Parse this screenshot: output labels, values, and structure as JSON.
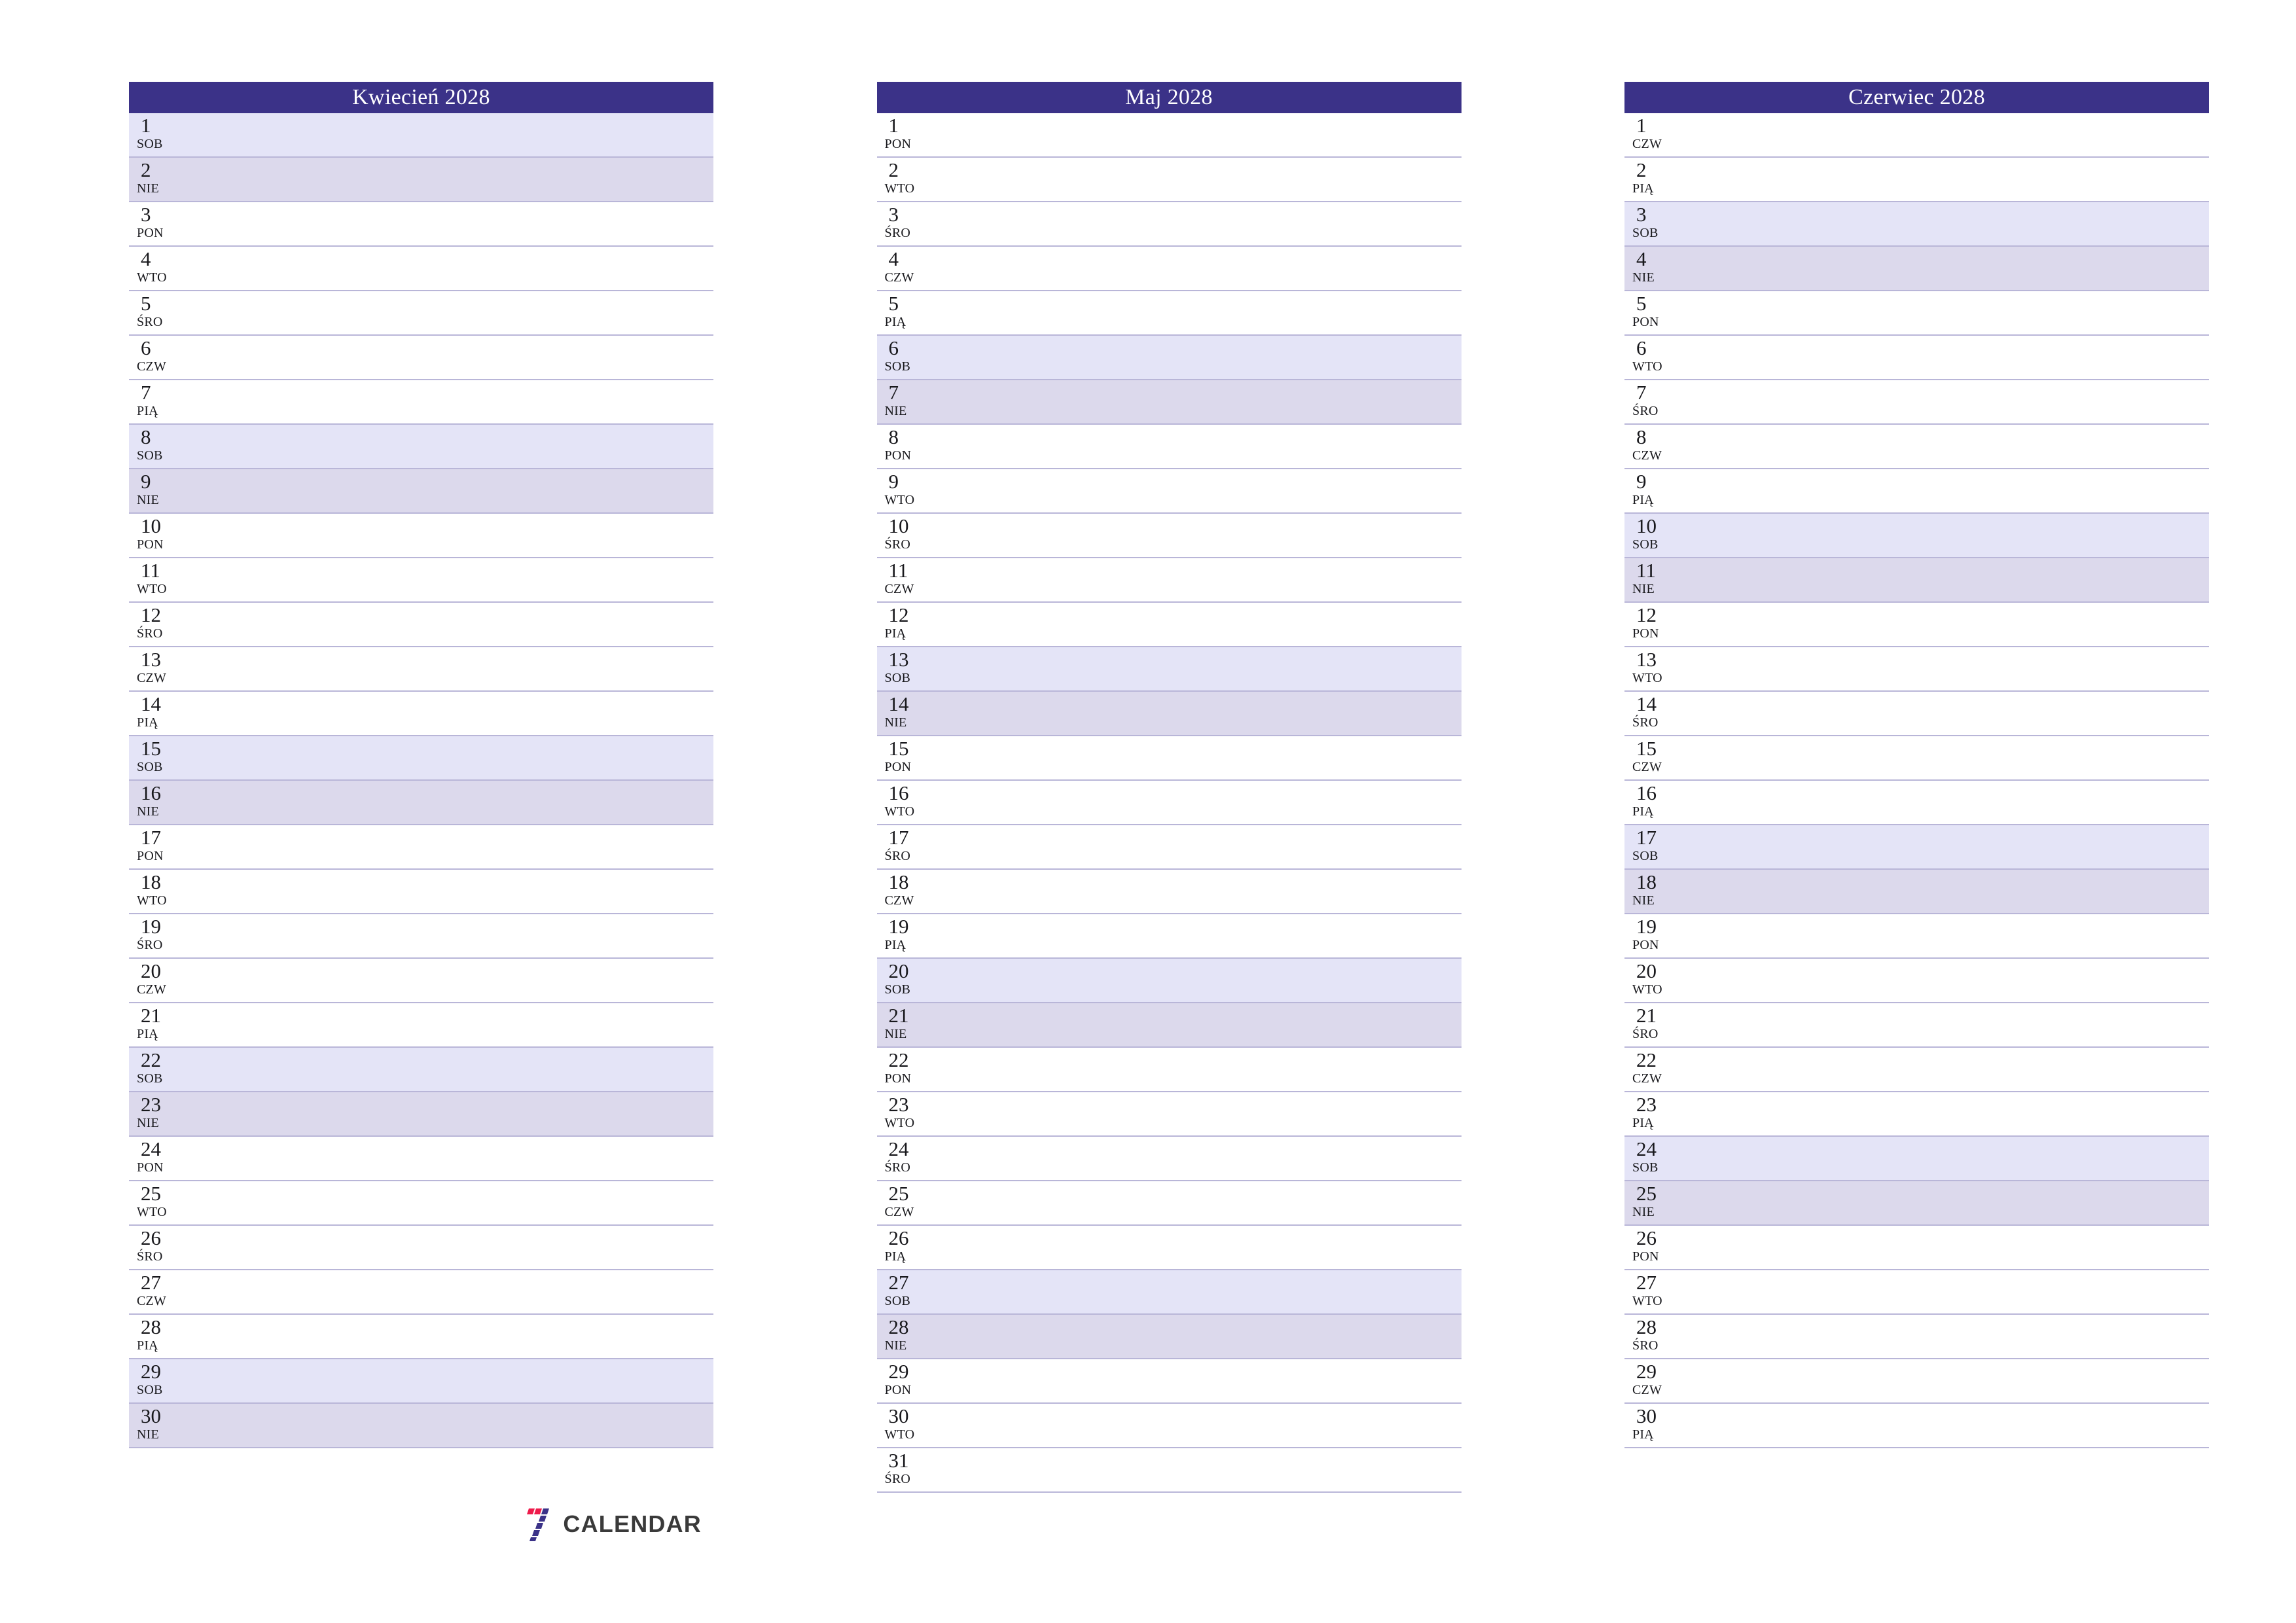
{
  "page": {
    "header_bg": "#3b3288",
    "saturday_bg": "#e4e4f7",
    "sunday_bg": "#dcd9ec",
    "weekday_bg": "#ffffff",
    "row_border": "#b9b6d8"
  },
  "brand": {
    "text": "CALENDAR",
    "mark_red": "#ee1b4b",
    "mark_navy": "#3b3288"
  },
  "months": [
    {
      "title": "Kwiecień 2028",
      "days": [
        {
          "num": "1",
          "name": "SOB",
          "type": "sat"
        },
        {
          "num": "2",
          "name": "NIE",
          "type": "sun"
        },
        {
          "num": "3",
          "name": "PON",
          "type": "wd"
        },
        {
          "num": "4",
          "name": "WTO",
          "type": "wd"
        },
        {
          "num": "5",
          "name": "ŚRO",
          "type": "wd"
        },
        {
          "num": "6",
          "name": "CZW",
          "type": "wd"
        },
        {
          "num": "7",
          "name": "PIĄ",
          "type": "wd"
        },
        {
          "num": "8",
          "name": "SOB",
          "type": "sat"
        },
        {
          "num": "9",
          "name": "NIE",
          "type": "sun"
        },
        {
          "num": "10",
          "name": "PON",
          "type": "wd"
        },
        {
          "num": "11",
          "name": "WTO",
          "type": "wd"
        },
        {
          "num": "12",
          "name": "ŚRO",
          "type": "wd"
        },
        {
          "num": "13",
          "name": "CZW",
          "type": "wd"
        },
        {
          "num": "14",
          "name": "PIĄ",
          "type": "wd"
        },
        {
          "num": "15",
          "name": "SOB",
          "type": "sat"
        },
        {
          "num": "16",
          "name": "NIE",
          "type": "sun"
        },
        {
          "num": "17",
          "name": "PON",
          "type": "wd"
        },
        {
          "num": "18",
          "name": "WTO",
          "type": "wd"
        },
        {
          "num": "19",
          "name": "ŚRO",
          "type": "wd"
        },
        {
          "num": "20",
          "name": "CZW",
          "type": "wd"
        },
        {
          "num": "21",
          "name": "PIĄ",
          "type": "wd"
        },
        {
          "num": "22",
          "name": "SOB",
          "type": "sat"
        },
        {
          "num": "23",
          "name": "NIE",
          "type": "sun"
        },
        {
          "num": "24",
          "name": "PON",
          "type": "wd"
        },
        {
          "num": "25",
          "name": "WTO",
          "type": "wd"
        },
        {
          "num": "26",
          "name": "ŚRO",
          "type": "wd"
        },
        {
          "num": "27",
          "name": "CZW",
          "type": "wd"
        },
        {
          "num": "28",
          "name": "PIĄ",
          "type": "wd"
        },
        {
          "num": "29",
          "name": "SOB",
          "type": "sat"
        },
        {
          "num": "30",
          "name": "NIE",
          "type": "sun"
        }
      ]
    },
    {
      "title": "Maj 2028",
      "days": [
        {
          "num": "1",
          "name": "PON",
          "type": "wd"
        },
        {
          "num": "2",
          "name": "WTO",
          "type": "wd"
        },
        {
          "num": "3",
          "name": "ŚRO",
          "type": "wd"
        },
        {
          "num": "4",
          "name": "CZW",
          "type": "wd"
        },
        {
          "num": "5",
          "name": "PIĄ",
          "type": "wd"
        },
        {
          "num": "6",
          "name": "SOB",
          "type": "sat"
        },
        {
          "num": "7",
          "name": "NIE",
          "type": "sun"
        },
        {
          "num": "8",
          "name": "PON",
          "type": "wd"
        },
        {
          "num": "9",
          "name": "WTO",
          "type": "wd"
        },
        {
          "num": "10",
          "name": "ŚRO",
          "type": "wd"
        },
        {
          "num": "11",
          "name": "CZW",
          "type": "wd"
        },
        {
          "num": "12",
          "name": "PIĄ",
          "type": "wd"
        },
        {
          "num": "13",
          "name": "SOB",
          "type": "sat"
        },
        {
          "num": "14",
          "name": "NIE",
          "type": "sun"
        },
        {
          "num": "15",
          "name": "PON",
          "type": "wd"
        },
        {
          "num": "16",
          "name": "WTO",
          "type": "wd"
        },
        {
          "num": "17",
          "name": "ŚRO",
          "type": "wd"
        },
        {
          "num": "18",
          "name": "CZW",
          "type": "wd"
        },
        {
          "num": "19",
          "name": "PIĄ",
          "type": "wd"
        },
        {
          "num": "20",
          "name": "SOB",
          "type": "sat"
        },
        {
          "num": "21",
          "name": "NIE",
          "type": "sun"
        },
        {
          "num": "22",
          "name": "PON",
          "type": "wd"
        },
        {
          "num": "23",
          "name": "WTO",
          "type": "wd"
        },
        {
          "num": "24",
          "name": "ŚRO",
          "type": "wd"
        },
        {
          "num": "25",
          "name": "CZW",
          "type": "wd"
        },
        {
          "num": "26",
          "name": "PIĄ",
          "type": "wd"
        },
        {
          "num": "27",
          "name": "SOB",
          "type": "sat"
        },
        {
          "num": "28",
          "name": "NIE",
          "type": "sun"
        },
        {
          "num": "29",
          "name": "PON",
          "type": "wd"
        },
        {
          "num": "30",
          "name": "WTO",
          "type": "wd"
        },
        {
          "num": "31",
          "name": "ŚRO",
          "type": "wd"
        }
      ]
    },
    {
      "title": "Czerwiec 2028",
      "days": [
        {
          "num": "1",
          "name": "CZW",
          "type": "wd"
        },
        {
          "num": "2",
          "name": "PIĄ",
          "type": "wd"
        },
        {
          "num": "3",
          "name": "SOB",
          "type": "sat"
        },
        {
          "num": "4",
          "name": "NIE",
          "type": "sun"
        },
        {
          "num": "5",
          "name": "PON",
          "type": "wd"
        },
        {
          "num": "6",
          "name": "WTO",
          "type": "wd"
        },
        {
          "num": "7",
          "name": "ŚRO",
          "type": "wd"
        },
        {
          "num": "8",
          "name": "CZW",
          "type": "wd"
        },
        {
          "num": "9",
          "name": "PIĄ",
          "type": "wd"
        },
        {
          "num": "10",
          "name": "SOB",
          "type": "sat"
        },
        {
          "num": "11",
          "name": "NIE",
          "type": "sun"
        },
        {
          "num": "12",
          "name": "PON",
          "type": "wd"
        },
        {
          "num": "13",
          "name": "WTO",
          "type": "wd"
        },
        {
          "num": "14",
          "name": "ŚRO",
          "type": "wd"
        },
        {
          "num": "15",
          "name": "CZW",
          "type": "wd"
        },
        {
          "num": "16",
          "name": "PIĄ",
          "type": "wd"
        },
        {
          "num": "17",
          "name": "SOB",
          "type": "sat"
        },
        {
          "num": "18",
          "name": "NIE",
          "type": "sun"
        },
        {
          "num": "19",
          "name": "PON",
          "type": "wd"
        },
        {
          "num": "20",
          "name": "WTO",
          "type": "wd"
        },
        {
          "num": "21",
          "name": "ŚRO",
          "type": "wd"
        },
        {
          "num": "22",
          "name": "CZW",
          "type": "wd"
        },
        {
          "num": "23",
          "name": "PIĄ",
          "type": "wd"
        },
        {
          "num": "24",
          "name": "SOB",
          "type": "sat"
        },
        {
          "num": "25",
          "name": "NIE",
          "type": "sun"
        },
        {
          "num": "26",
          "name": "PON",
          "type": "wd"
        },
        {
          "num": "27",
          "name": "WTO",
          "type": "wd"
        },
        {
          "num": "28",
          "name": "ŚRO",
          "type": "wd"
        },
        {
          "num": "29",
          "name": "CZW",
          "type": "wd"
        },
        {
          "num": "30",
          "name": "PIĄ",
          "type": "wd"
        }
      ]
    }
  ]
}
